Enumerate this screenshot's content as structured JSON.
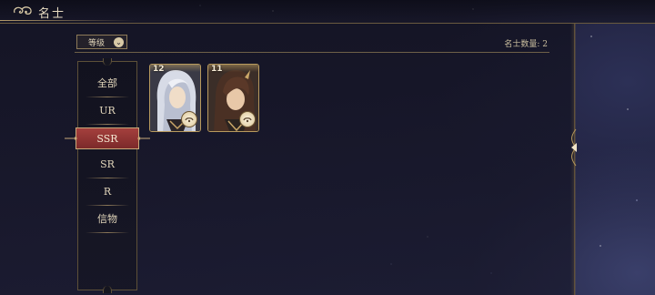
{
  "header": {
    "title": "名士"
  },
  "filter": {
    "level_label": "等级",
    "count_label": "名士数量: 2"
  },
  "categories": [
    {
      "label": "全部",
      "active": false
    },
    {
      "label": "UR",
      "active": false
    },
    {
      "label": "SSR",
      "active": true
    },
    {
      "label": "SR",
      "active": false
    },
    {
      "label": "R",
      "active": false
    },
    {
      "label": "信物",
      "active": false
    }
  ],
  "heroes": [
    {
      "level": "12",
      "hair": "white-silver",
      "icon": "character-portrait-icon"
    },
    {
      "level": "11",
      "hair": "dark-brown",
      "icon": "character-portrait-icon"
    }
  ],
  "colors": {
    "accent_gold": "#b89a5e",
    "active_tab": "#a4403d",
    "text": "#e2d6bb"
  }
}
